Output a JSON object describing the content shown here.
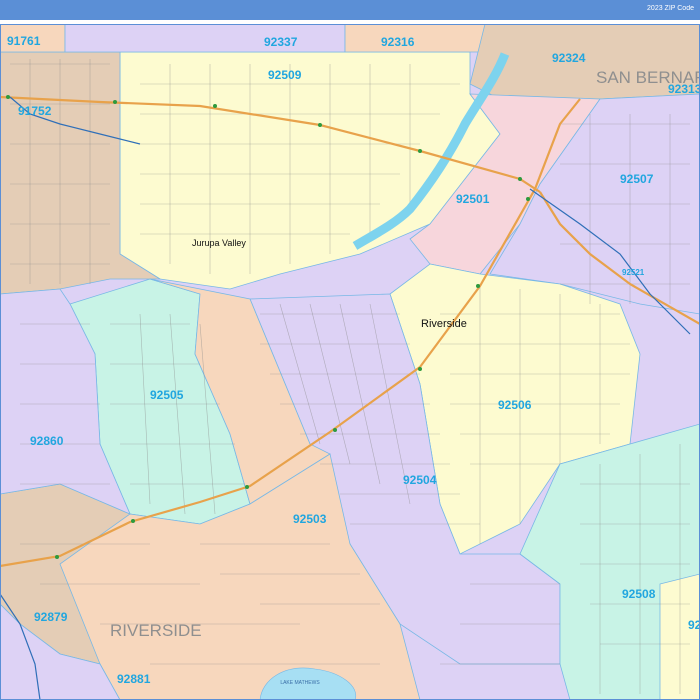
{
  "header": {
    "title": "2023 ZIP Code"
  },
  "county_label": "RIVERSIDE",
  "county_label_ne": "SAN BERNARDINO",
  "cities": [
    {
      "id": "riverside",
      "name": "Riverside"
    },
    {
      "id": "jurupa-valley",
      "name": "Jurupa Valley"
    }
  ],
  "zip_labels": [
    "91761",
    "92337",
    "92316",
    "92324",
    "92313",
    "92509",
    "91752",
    "92501",
    "92507",
    "92521",
    "92505",
    "92506",
    "92860",
    "92504",
    "92503",
    "92508",
    "92879",
    "92881",
    "92"
  ],
  "water": {
    "lake_label": "LAKE MATHEWS"
  },
  "colors": {
    "lavender": "#ddd2f5",
    "yellow": "#fdfbd0",
    "peach": "#f7d7bd",
    "pink": "#f7d6dc",
    "mint": "#c8f3e6",
    "tan": "#e4cdb6",
    "river": "#7dd3ee",
    "zip_text": "#21a6df"
  }
}
